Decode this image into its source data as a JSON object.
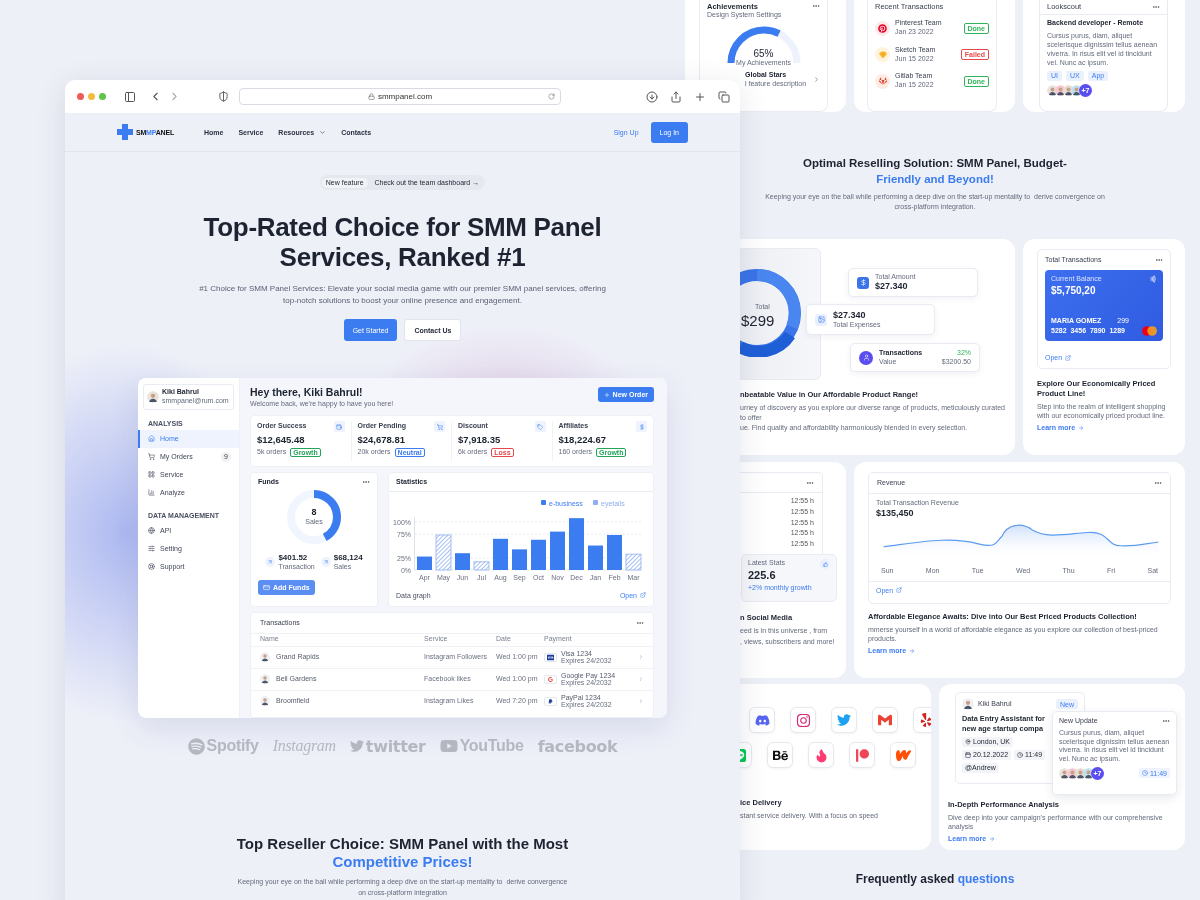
{
  "browser": {
    "url": "smmpanel.com"
  },
  "site": {
    "logo": [
      {
        "text": "SM",
        "accent": false
      },
      {
        "text": "MP",
        "accent": true
      },
      {
        "text": "ANEL",
        "accent": false
      }
    ],
    "nav": [
      {
        "label": "Home",
        "dropdown": false
      },
      {
        "label": "Service",
        "dropdown": false
      },
      {
        "label": "Resources",
        "dropdown": true
      },
      {
        "label": "Contacts",
        "dropdown": false
      }
    ],
    "sign_up": "Sign Up",
    "log_in": "Log In",
    "hero": {
      "badge": "New feature",
      "badge_link": "Check out the team dashboard →",
      "title_lines": [
        "Top-Rated Choice for SMM Panel",
        "Services, Ranked #1"
      ],
      "subtitle": "#1 Choice for SMM Panel Services: Elevate your social media game with our premier SMM panel services, offering top-notch solutions to boost your online presence and engagement.",
      "primary": "Get Started",
      "secondary": "Contact Us"
    },
    "dashboard": {
      "user": {
        "name": "Kiki Bahrul",
        "email": "smmpanel@rum.com"
      },
      "sections": [
        {
          "title": "ANALYSIS",
          "items": [
            {
              "label": "Home",
              "selected": true
            },
            {
              "label": "My Orders",
              "selected": false,
              "badge": "9"
            },
            {
              "label": "Service",
              "selected": false
            },
            {
              "label": "Analyze",
              "selected": false
            }
          ]
        },
        {
          "title": "DATA MANAGEMENT",
          "items": [
            {
              "label": "API",
              "selected": false
            },
            {
              "label": "Setting",
              "selected": false
            },
            {
              "label": "Support",
              "selected": false
            }
          ]
        }
      ],
      "greeting": "Hey there, Kiki Bahrul!",
      "welcome": "Welcome back, we're happy to have you here!",
      "new_order": "New Order",
      "stats": [
        {
          "label": "Order Success",
          "value": "$12,645.48",
          "orders": "5k orders",
          "tag": "Growth",
          "color": "#22a559"
        },
        {
          "label": "Order Pending",
          "value": "$24,678.81",
          "orders": "20k orders",
          "tag": "Neutral",
          "color": "#3b7cf0"
        },
        {
          "label": "Discount",
          "value": "$7,918.35",
          "orders": "6k orders",
          "tag": "Loss",
          "color": "#e5484d"
        },
        {
          "label": "Affiliates",
          "value": "$18,224.67",
          "orders": "160 orders",
          "tag": "Growth",
          "color": "#22a559"
        }
      ],
      "funds": {
        "title": "Funds",
        "count": "8",
        "count_label": "Sales",
        "figures": [
          {
            "value": "$401.52",
            "label": "Transaction"
          },
          {
            "value": "$68,124",
            "label": "Sales"
          }
        ],
        "button": "Add Funds"
      },
      "statistics": {
        "title": "Statistics",
        "footer": "Data graph",
        "link": "Open",
        "chart_data": {
          "type": "bar",
          "categories": [
            "Apr",
            "May",
            "Jun",
            "Jul",
            "Aug",
            "Sep",
            "Oct",
            "Nov",
            "Dec",
            "Jan",
            "Feb",
            "Mar"
          ],
          "series": [
            {
              "name": "e-business",
              "color": "#3b7cf0",
              "values": [
                28,
                null,
                35,
                null,
                65,
                43,
                63,
                80,
                108,
                51,
                73,
                null
              ]
            },
            {
              "name": "eyetails",
              "color": "#8fb0f0",
              "values": [
                null,
                73,
                null,
                17,
                null,
                null,
                null,
                null,
                null,
                null,
                null,
                33
              ]
            }
          ],
          "stacked": true,
          "grid": true,
          "ylim": [
            0,
            110
          ],
          "yticks": [
            {
              "value": 0,
              "label": "0%"
            },
            {
              "value": 25,
              "label": "25%"
            },
            {
              "value": 75,
              "label": "75%"
            },
            {
              "value": 100,
              "label": "100%"
            }
          ]
        }
      },
      "transactions": {
        "title": "Transactions",
        "columns": [
          "Name",
          "Service",
          "Date",
          "Payment"
        ],
        "rows": [
          {
            "name": "Grand Rapids",
            "service": "Instagram Followers",
            "date": "Wed 1:00 pm",
            "method": "Visa 1234",
            "expires": "Expires 24/2032"
          },
          {
            "name": "Bell Gardens",
            "service": "Facebook likes",
            "date": "Wed 1:00 pm",
            "method": "Google Pay 1234",
            "expires": "Expires 24/2032"
          },
          {
            "name": "Broomfield",
            "service": "Instagram Likes",
            "date": "Wed 7:20 pm",
            "method": "PayPal 1234",
            "expires": "Expires 24/2032"
          }
        ]
      }
    },
    "brands": [
      {
        "label": "Spotify"
      },
      {
        "label": "Instagram"
      },
      {
        "label": "twitter"
      },
      {
        "label": "YouTube"
      },
      {
        "label": "facebook"
      }
    ],
    "section": {
      "title": "Top Reseller Choice: SMM Panel with the Most",
      "title_accent": "Competitive Prices!",
      "text_lines": [
        "Keeping your eye on the ball while performing a deep dive on the start-up mentality to  derive convergence",
        "on cross-platform integration"
      ]
    }
  },
  "showcase": {
    "achievements": {
      "title": "Achievements",
      "subtitle": "Design System Settings",
      "percent": "65%",
      "caption": "My Achievements",
      "item_title": "Global Stars",
      "item_text": "l feature description"
    },
    "recent": {
      "title": "Recent Transactions",
      "rows": [
        {
          "name": "Pinterest Team",
          "date": "Jan 23 2022",
          "status": "Done",
          "color": "#2fb45a"
        },
        {
          "name": "Sketch Team",
          "date": "Jun 15 2022",
          "status": "Failed",
          "color": "#e5484d"
        },
        {
          "name": "Gitlab Team",
          "date": "Jan 15 2022",
          "status": "Done",
          "color": "#2fb45a"
        }
      ]
    },
    "job": {
      "title": "Lookscout",
      "role": "Backend developer - Remote",
      "text": "Cursus purus, diam, aliquet scelerisque dignissim tellus aenean viverra. In risus elit vel id tincidunt vel. Nunc ac ipsum.",
      "tags": [
        "UI",
        "UX",
        "App"
      ],
      "more": "+7"
    },
    "heading": {
      "title": "Optimal Reselling Solution: SMM Panel, Budget-",
      "title_accent": "Friendly and Beyond!",
      "text": "Keeping your eye on the ball while performing a deep dive on the start-up mentality to  derive convergence on cross-platform integration."
    },
    "value_card": {
      "total_label": "Total",
      "total": "$299",
      "amount_label": "Total Amount",
      "amount": "$27.340",
      "expenses": "$27.340",
      "expenses_label": "Total Expenses",
      "tx_label": "Transactions",
      "tx_sub": "Value",
      "tx_change": "32%",
      "tx_value": "$3200.50",
      "title": "nbeatable Value in Our Affordable Product Range!",
      "text_lines": [
        "urney of discovery as you explore our diverse range of products, meticulously curated to offer",
        "ue. Find quality and affordability harmoniously blended in every selection."
      ]
    },
    "balance_card": {
      "title": "Total Transactions",
      "balance_label": "Current Balance",
      "balance": "$5,750,20",
      "holder": "MARIA GOMEZ",
      "cvv": "299",
      "number": "5282  3456  7890  1289",
      "link": "Open",
      "heading": "Explore Our Economically Priced Product Line!",
      "text": "Step into the realm of intelligent shopping with our economically priced product line.",
      "more": "Learn more"
    },
    "social_card": {
      "times": [
        "12:55 h",
        "12:55 h",
        "12:55 h",
        "12:55 h",
        "12:55 h"
      ],
      "stats_label": "Latest Stats",
      "stats_value": "225.6",
      "growth": "+2% monthly growth",
      "title": "n Social Media",
      "text_lines": [
        "eed is in this universe , from",
        ", views, subscribers and more!"
      ]
    },
    "revenue_card": {
      "title": "Revenue",
      "label": "Total Transaction Revenue",
      "value": "$135,450",
      "days": [
        "Sun",
        "Mon",
        "Tue",
        "Wed",
        "Thu",
        "Fri",
        "Sat"
      ],
      "link": "Open",
      "heading": "Affordable Elegance Awaits: Dive into Our Best Priced Products Collection!",
      "text": "mmerse yourself in a world of affordable elegance as you explore our collection of best-priced products.",
      "more": "Learn more"
    },
    "delivery_card": {
      "title": "ice Delivery",
      "text": "stant service delivery. With a focus on speed"
    },
    "analysis_card": {
      "author": "Kiki Bahrul",
      "badge": "New",
      "job_lines": [
        "Data Entry Assistant for",
        "new age startup compa"
      ],
      "chips": [
        "London, UK",
        "20.12.2022",
        "11:49",
        "@Andrew"
      ],
      "update_title": "New Update",
      "update_text": "Cursus purus, diam, aliquet scelerisque dignissim tellus aenean viverra. In risus elit vel id tincidunt vel. Nunc ac ipsum.",
      "update_more": "+7",
      "update_time": "11:49",
      "heading": "In-Depth Performance Analysis",
      "text": "Dive deep into your campaign's performance with our comprehensive analysis",
      "more": "Learn more"
    },
    "faq": {
      "title": "Frequently asked",
      "accent": "questions"
    }
  }
}
